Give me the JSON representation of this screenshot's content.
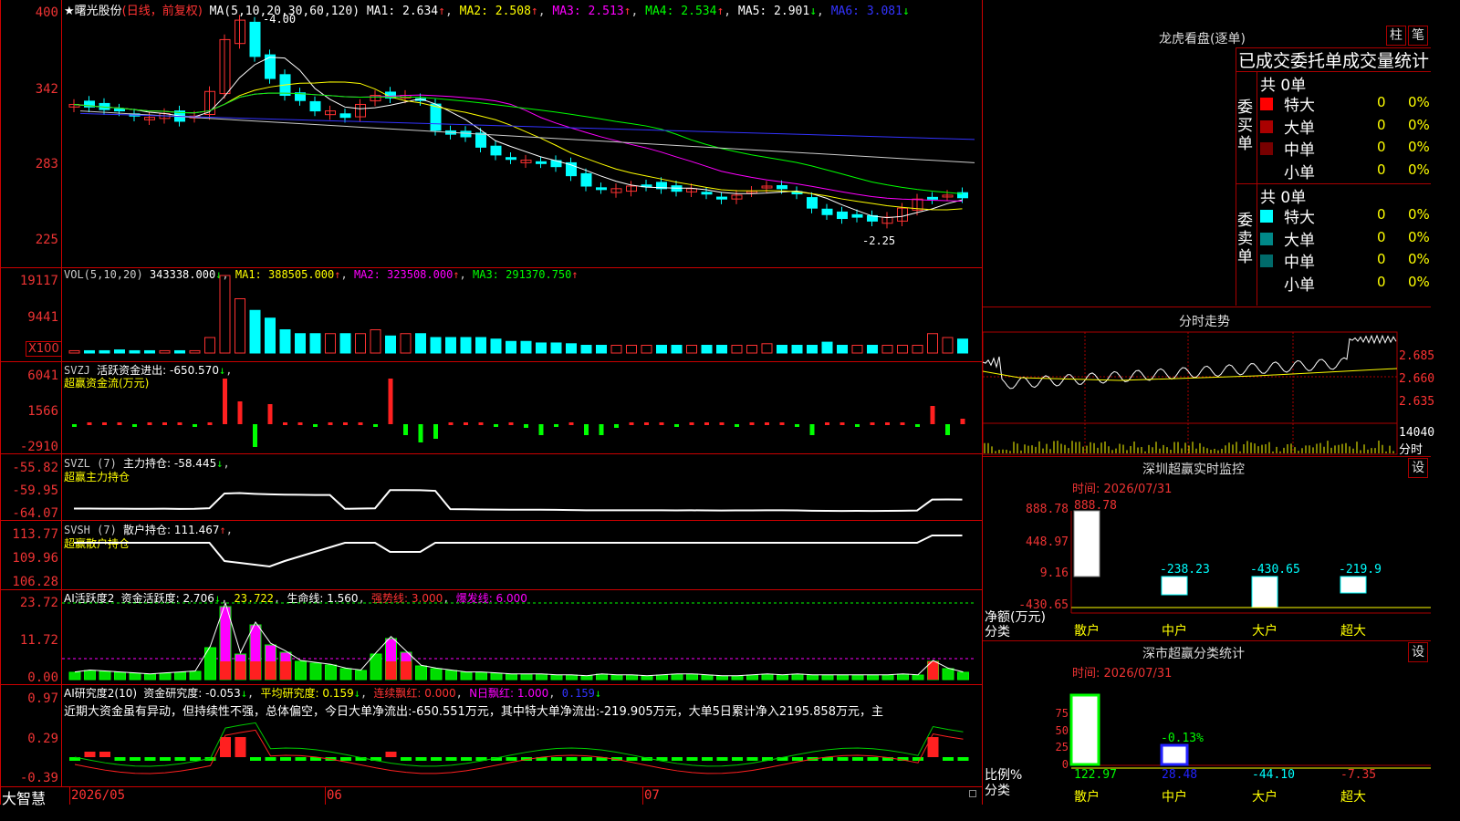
{
  "stock": {
    "name": "曙光股份",
    "star": "★",
    "period": "(日线，前复权)"
  },
  "ma_header": {
    "params": "MA(5,10,20,30,60,120)",
    "ma1": "MA1: 2.634",
    "ma2": "MA2: 2.508",
    "ma3": "MA3: 2.513",
    "ma4": "MA4: 2.534",
    "ma5": "MA5: 2.901",
    "ma6": "MA6: 3.081",
    "up": "↑",
    "down": "↓"
  },
  "price_axis": [
    "400",
    "342",
    "283",
    "225"
  ],
  "price_marks": {
    "high": "4.00",
    "low": "2.25"
  },
  "vol_panel": {
    "params": "VOL(5,10,20)",
    "vol": "343338.000",
    "ma1": "MA1: 388505.000",
    "ma2": "MA2: 323508.000",
    "ma3": "MA3: 291370.750",
    "axis": [
      "19117",
      "9441"
    ],
    "unit": "X100"
  },
  "svzj": {
    "title": "SVZJ",
    "label": "活跃资金进出: -650.570",
    "sub": "超赢资金流(万元)",
    "axis": [
      "6041",
      "1566",
      "-2910"
    ]
  },
  "svzl": {
    "title": "SVZL (7)",
    "label": "主力持仓: -58.445",
    "sub": "超赢主力持仓",
    "axis": [
      "-55.82",
      "-59.95",
      "-64.07"
    ]
  },
  "svsh": {
    "title": "SVSH (7)",
    "label": "散户持仓: 111.467",
    "sub": "超赢散户持仓",
    "axis": [
      "113.77",
      "109.96",
      "106.28"
    ]
  },
  "ai_active": {
    "title": "AI活跃度2",
    "a": "资金活跃度: 2.706",
    "b": "23.722",
    "c": "生命线: 1.560",
    "d": "强势线: 3.000",
    "e": "爆发线: 6.000",
    "axis": [
      "23.72",
      "11.72",
      "0.00"
    ]
  },
  "ai_research": {
    "title": "AI研究度2(10)",
    "a": "资金研究度: -0.053",
    "b": "平均研究度: 0.159",
    "c": "连续飘红: 0.000",
    "d": "N日飘红: 1.000",
    "e": "0.159",
    "axis": [
      "0.97",
      "0.29",
      "-0.39"
    ],
    "note": "近期大资金虽有异动，但持续性不强，总体偏空，今日大单净流出:-650.551万元，其中特大单净流出:-219.905万元，大单5日累计净入2195.858万元，主"
  },
  "dates": {
    "a": "2026/05",
    "b": "06",
    "c": "07"
  },
  "brand": "大智慧",
  "right": {
    "lhb_title": "龙虎看盘(逐单)",
    "tab1": "柱",
    "tab2": "笔",
    "stat_title": "已成交委托单成交量统计",
    "buy_label": "委买单",
    "sell_label": "委卖单",
    "buy_total": "共 0单",
    "sell_total": "共 0单",
    "buy_rows": [
      {
        "name": "特大",
        "v": "0",
        "p": "0%",
        "color": "#ff0000"
      },
      {
        "name": "大单",
        "v": "0",
        "p": "0%",
        "color": "#aa0000"
      },
      {
        "name": "中单",
        "v": "0",
        "p": "0%",
        "color": "#770000"
      },
      {
        "name": "小单",
        "v": "0",
        "p": "0%",
        "color": "#000000"
      }
    ],
    "sell_rows": [
      {
        "name": "特大",
        "v": "0",
        "p": "0%",
        "color": "#00ffff"
      },
      {
        "name": "大单",
        "v": "0",
        "p": "0%",
        "color": "#008888"
      },
      {
        "name": "中单",
        "v": "0",
        "p": "0%",
        "color": "#006a6a"
      },
      {
        "name": "小单",
        "v": "0",
        "p": "0%",
        "color": "#000000"
      }
    ],
    "fs_title": "分时走势",
    "fs_axis": [
      "2.685",
      "2.660",
      "2.635"
    ],
    "fs_vol": "14040",
    "fs_vol_unit": "分时",
    "sz_title": "深圳超赢实时监控",
    "sz_time": "时间: 2026/07/31",
    "sz_axis": [
      "888.78",
      "448.97",
      "9.16",
      "-430.65"
    ],
    "sz_values": [
      "888.78",
      "-238.23",
      "-430.65",
      "-219.9"
    ],
    "sz_ylabel": "净额(万元)",
    "sz_xlabel": "分类",
    "sz_cats": [
      "散户",
      "中户",
      "大户",
      "超大"
    ],
    "set": "设",
    "ss_title": "深市超赢分类统计",
    "ss_time": "时间: 2026/07/31",
    "ss_axis": [
      "75",
      "50",
      "25",
      "0"
    ],
    "ss_pct": "-0.13%",
    "ss_values": [
      "122.97",
      "28.48",
      "-44.10",
      "-7.35"
    ],
    "ss_ylabel": "比例%",
    "ss_xlabel": "分类",
    "ss_cats": [
      "散户",
      "中户",
      "大户",
      "超大"
    ]
  }
}
